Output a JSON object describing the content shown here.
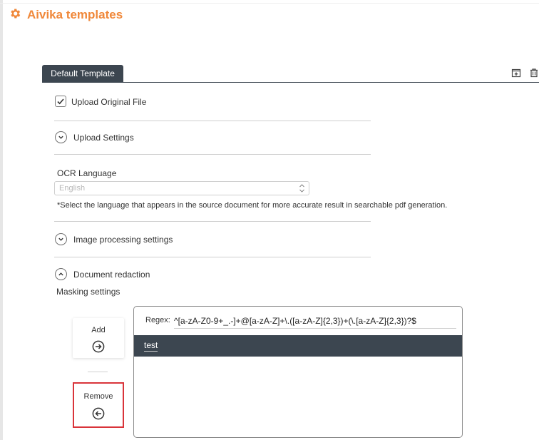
{
  "app": {
    "title": "Aivika templates",
    "accent_color": "#f0883a",
    "icon": "gear-icon"
  },
  "tabs": [
    {
      "label": "Default Template",
      "active": true
    }
  ],
  "toolbar": {
    "icons": [
      "add-template-icon",
      "delete-template-icon"
    ]
  },
  "form": {
    "upload_original": {
      "label": "Upload Original File",
      "checked": true
    },
    "sections": {
      "upload_settings": {
        "label": "Upload Settings",
        "expanded": false
      },
      "image_processing": {
        "label": "Image processing settings",
        "expanded": false
      },
      "document_redaction": {
        "label": "Document redaction",
        "expanded": true
      }
    },
    "ocr": {
      "label": "OCR Language",
      "value": "English",
      "hint": "*Select the language that appears in the source document for more accurate result in searchable pdf generation."
    },
    "masking": {
      "label": "Masking settings",
      "add_label": "Add",
      "remove_label": "Remove",
      "regex_label": "Regex:",
      "regex_value": "^[a-zA-Z0-9+_.-]+@[a-zA-Z]+\\.([a-zA-Z]{2,3})+(\\.[a-zA-Z]{2,3})?$",
      "items": [
        "test"
      ]
    }
  },
  "colors": {
    "tab_bg": "#3c4650",
    "selected_row_bg": "#3c4650",
    "highlight_border": "#d9343a"
  }
}
